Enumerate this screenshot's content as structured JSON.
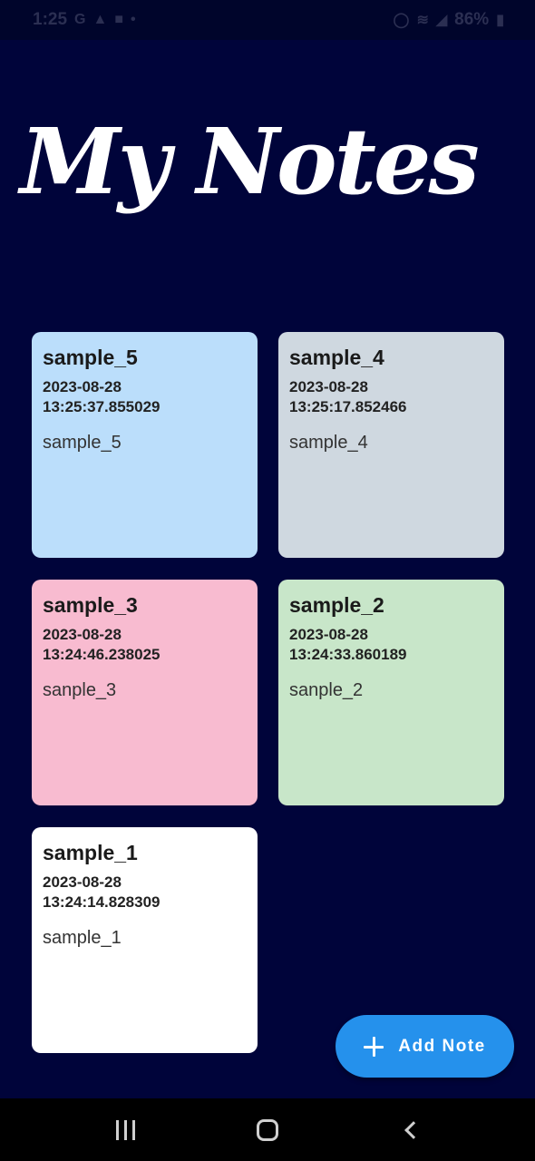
{
  "status_bar": {
    "time": "1:25",
    "left_icons": [
      "google-icon",
      "notification-icon",
      "message-icon",
      "dot-icon"
    ],
    "right_icons": [
      "alarm-icon",
      "wifi-icon",
      "signal-icon"
    ],
    "battery": "86%"
  },
  "header": {
    "title": "My Notes"
  },
  "notes": [
    {
      "title": "sample_5",
      "date": "2023-08-28\n13:25:37.855029",
      "body": "sample_5",
      "color": "#bbdefb"
    },
    {
      "title": "sample_4",
      "date": "2023-08-28\n13:25:17.852466",
      "body": "sample_4",
      "color": "#cfd8e0"
    },
    {
      "title": "sample_3",
      "date": "2023-08-28\n13:24:46.238025",
      "body": "sanple_3",
      "color": "#f8bbd0"
    },
    {
      "title": "sample_2",
      "date": "2023-08-28\n13:24:33.860189",
      "body": "sanple_2",
      "color": "#c8e6c9"
    },
    {
      "title": "sample_1",
      "date": "2023-08-28\n13:24:14.828309",
      "body": "sample_1",
      "color": "#ffffff"
    }
  ],
  "fab": {
    "label": "Add Note",
    "icon": "plus-icon",
    "color": "#2591ec"
  },
  "nav_bar": {
    "buttons": [
      "recents-icon",
      "home-icon",
      "back-icon"
    ]
  }
}
